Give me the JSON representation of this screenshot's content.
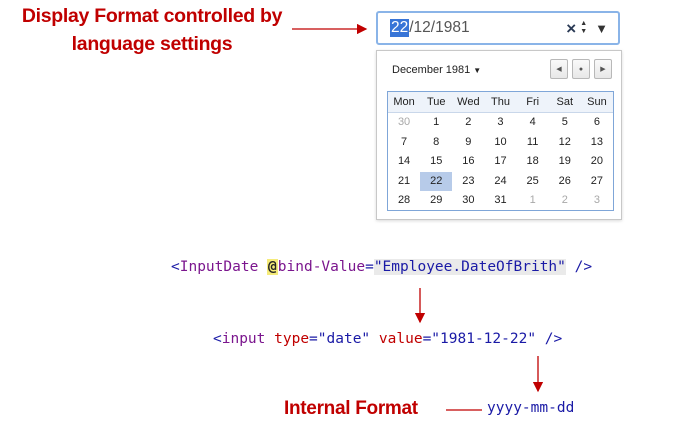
{
  "annotations": {
    "display_line1": "Display Format controlled by",
    "display_line2": "language settings",
    "internal": "Internal Format",
    "format_pattern": "yyyy-mm-dd"
  },
  "date_input": {
    "selected_segment": "22",
    "rest": "/12/1981",
    "clear_glyph": "×",
    "spin_up": "▲",
    "spin_down": "▼",
    "dropdown_glyph": "▼"
  },
  "calendar": {
    "month_label": "December 1981",
    "nav_prev": "◀",
    "nav_today": "●",
    "nav_next": "▶",
    "weekdays": [
      "Mon",
      "Tue",
      "Wed",
      "Thu",
      "Fri",
      "Sat",
      "Sun"
    ],
    "weeks": [
      [
        "30",
        "1",
        "2",
        "3",
        "4",
        "5",
        "6"
      ],
      [
        "7",
        "8",
        "9",
        "10",
        "11",
        "12",
        "13"
      ],
      [
        "14",
        "15",
        "16",
        "17",
        "18",
        "19",
        "20"
      ],
      [
        "21",
        "22",
        "23",
        "24",
        "25",
        "26",
        "27"
      ],
      [
        "28",
        "29",
        "30",
        "31",
        "1",
        "2",
        "3"
      ]
    ],
    "selected_day": "22"
  },
  "code_line1": {
    "open": "<",
    "tag": "InputDate",
    "razor": "@",
    "attr": "bind-Value",
    "eq": "=",
    "value": "\"Employee.DateOfBrith\"",
    "close": " />"
  },
  "code_line2": {
    "open": "<",
    "tag": "input",
    "attr1": "type",
    "eq1": "=",
    "value1": "\"date\"",
    "attr2": "value",
    "eq2": "=",
    "value2": "\"1981-12-22\"",
    "close": " />"
  },
  "colors": {
    "annotation": "#c00000",
    "tag": "#7b168e",
    "string": "#1a1aa6",
    "selected_day": "#b7cbe9"
  }
}
